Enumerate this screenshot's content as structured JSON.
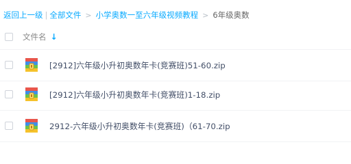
{
  "breadcrumb": {
    "back_label": "返回上一级",
    "all_files_label": "全部文件",
    "folder_label": "小学奥数一至六年级视频教程",
    "current_label": "6年级奥数",
    "bar_separator": "|",
    "arrow_separator": ">"
  },
  "table": {
    "name_header": "文件名",
    "sort_symbol": "↓"
  },
  "files": [
    {
      "name": "[2912]六年级小升初奥数年卡(竞赛班)51-60.zip",
      "icon": "zip-archive-icon"
    },
    {
      "name": "[2912]六年级小升初奥数年卡(竞赛班)1-18.zip",
      "icon": "zip-archive-icon"
    },
    {
      "name": "2912-六年级小升初奥数年卡(竞赛班)（61-70.zip",
      "icon": "zip-archive-icon"
    }
  ],
  "colors": {
    "link": "#09aaff",
    "text": "#424e67",
    "zip_red": "#e8564c",
    "zip_blue": "#3f8ee8",
    "zip_green": "#6cc24a",
    "zip_yellow": "#f5c22b"
  }
}
